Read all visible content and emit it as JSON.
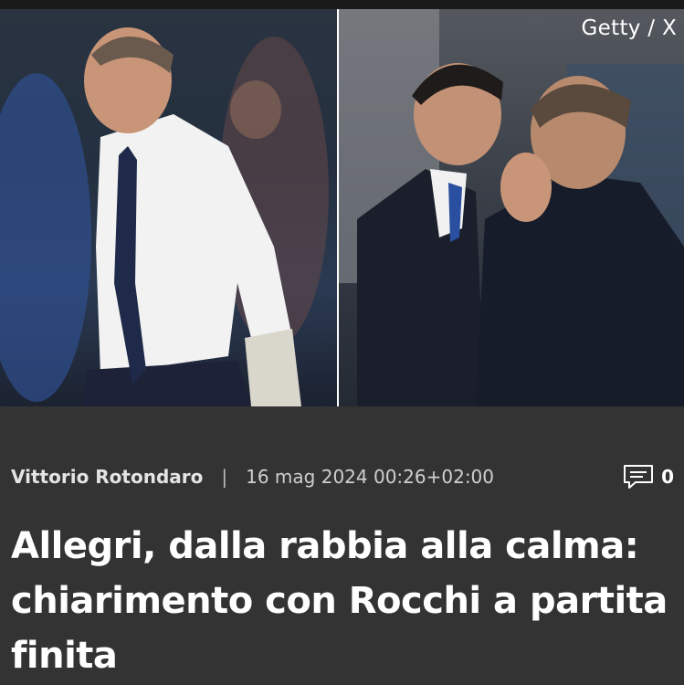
{
  "hero": {
    "photo_credit": "Getty / X"
  },
  "article": {
    "author": "Vittorio Rotondaro",
    "separator": "|",
    "date": "16 mag 2024 00:26+02:00",
    "comment_count": "0",
    "title": "Allegri, dalla rabbia alla calma: chiarimento con Rocchi a partita finita"
  },
  "icons": {
    "comments": "comment-icon"
  },
  "colors": {
    "background": "#333333",
    "text": "#ffffff",
    "meta_text": "#d8d8d8"
  }
}
